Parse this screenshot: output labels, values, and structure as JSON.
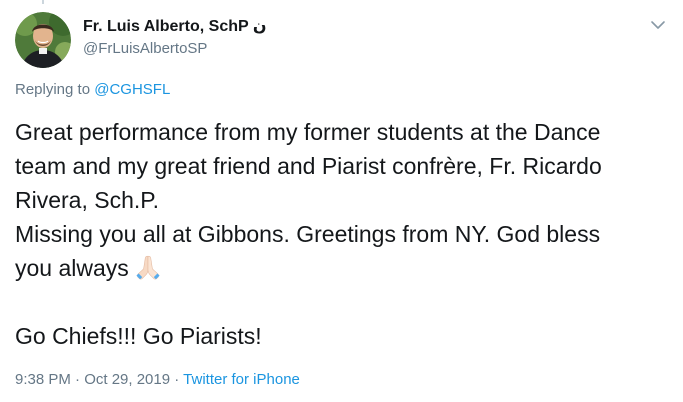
{
  "tweet": {
    "author": {
      "display_name": "Fr. Luis Alberto, SchP",
      "name_suffix_glyph": "ن",
      "handle": "@FrLuisAlbertoSP"
    },
    "replying_prefix": "Replying to",
    "replying_handle": "@CGHSFL",
    "text_lines": [
      "Great performance from my former students at the Dance",
      "team and my great friend and Piarist confrère, Fr. Ricardo",
      "Rivera, Sch.P.",
      "Missing you all at Gibbons. Greetings from NY. God bless",
      "you always",
      "",
      "Go Chiefs!!! Go Piarists!"
    ],
    "emoji": "folded-hands",
    "timestamp": "9:38 PM · Oct 29, 2019",
    "separator": "·",
    "source": "Twitter for iPhone"
  },
  "icons": {
    "caret": "chevron-down-icon",
    "avatar": "avatar-photo"
  },
  "colors": {
    "text": "#14171a",
    "secondary": "#657786",
    "link": "#1b95e0"
  }
}
